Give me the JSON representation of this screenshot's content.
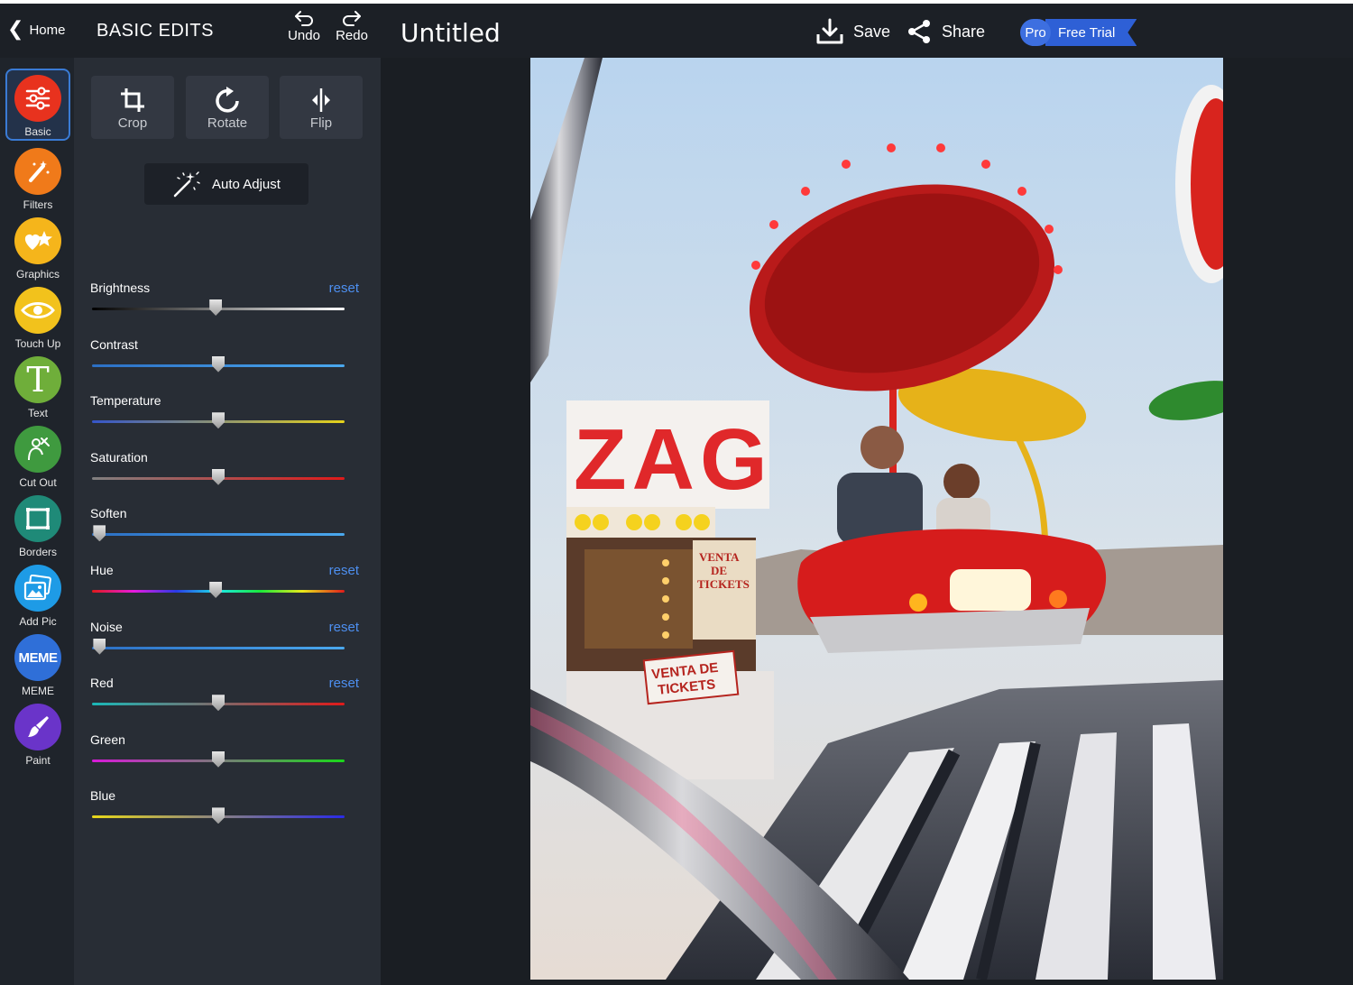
{
  "header": {
    "home_label": "Home",
    "panel_title": "BASIC EDITS",
    "undo_label": "Undo",
    "redo_label": "Redo",
    "document_title": "Untitled",
    "save_label": "Save",
    "share_label": "Share",
    "pro_label": "Pro",
    "trial_label": "Free Trial"
  },
  "rail": {
    "items": [
      {
        "label": "Basic",
        "icon": "sliders-icon",
        "color": "#e8321e",
        "active": true
      },
      {
        "label": "Filters",
        "icon": "magic-wand-icon",
        "color": "#f07a1a"
      },
      {
        "label": "Graphics",
        "icon": "heart-star-icon",
        "color": "#f5b51b"
      },
      {
        "label": "Touch Up",
        "icon": "eye-icon",
        "color": "#f2c21c"
      },
      {
        "label": "Text",
        "icon": "text-t-icon",
        "color": "#6fae3a"
      },
      {
        "label": "Cut Out",
        "icon": "cutout-figure-icon",
        "color": "#3f9a3f"
      },
      {
        "label": "Borders",
        "icon": "frame-icon",
        "color": "#1f8a78"
      },
      {
        "label": "Add Pic",
        "icon": "add-picture-icon",
        "color": "#1e9be6"
      },
      {
        "label": "MEME",
        "icon": "meme-icon",
        "color": "#2f6fd8"
      },
      {
        "label": "Paint",
        "icon": "paintbrush-icon",
        "color": "#6a34c9"
      }
    ]
  },
  "tools": {
    "crop_label": "Crop",
    "rotate_label": "Rotate",
    "flip_label": "Flip",
    "auto_adjust_label": "Auto Adjust"
  },
  "sliders": [
    {
      "name": "Brightness",
      "value": 0.49,
      "reset": "reset",
      "gradient": [
        "#000000",
        "#ffffff"
      ]
    },
    {
      "name": "Contrast",
      "value": 0.5,
      "gradient": [
        "#2c6fc4",
        "#4aa8ee"
      ]
    },
    {
      "name": "Temperature",
      "value": 0.5,
      "gradient": [
        "#3555c9",
        "#e5d21a"
      ]
    },
    {
      "name": "Saturation",
      "value": 0.5,
      "gradient": [
        "#808080",
        "#e01a1a"
      ]
    },
    {
      "name": "Soften",
      "value": 0.03,
      "gradient": [
        "#2c6fc4",
        "#4aa8ee"
      ]
    },
    {
      "name": "Hue",
      "value": 0.49,
      "reset": "reset",
      "gradient": [
        "#e01a1a",
        "#e81ae0",
        "#2a3ae8",
        "#1ae8e8",
        "#1ae83a",
        "#e8e81a",
        "#e01a1a"
      ]
    },
    {
      "name": "Noise",
      "value": 0.03,
      "reset": "reset",
      "gradient": [
        "#2c6fc4",
        "#4aa8ee"
      ]
    },
    {
      "name": "Red",
      "value": 0.5,
      "reset": "reset",
      "gradient": [
        "#1ab8b8",
        "#e01a1a"
      ]
    },
    {
      "name": "Green",
      "value": 0.5,
      "gradient": [
        "#d81ad8",
        "#1ad81a"
      ]
    },
    {
      "name": "Blue",
      "value": 0.5,
      "gradient": [
        "#e8d81a",
        "#2a2ae8"
      ]
    }
  ],
  "photo": {
    "signs": [
      "ZAG",
      "VENTA DE TICKETS",
      "VENTA DE TICKETS"
    ]
  }
}
